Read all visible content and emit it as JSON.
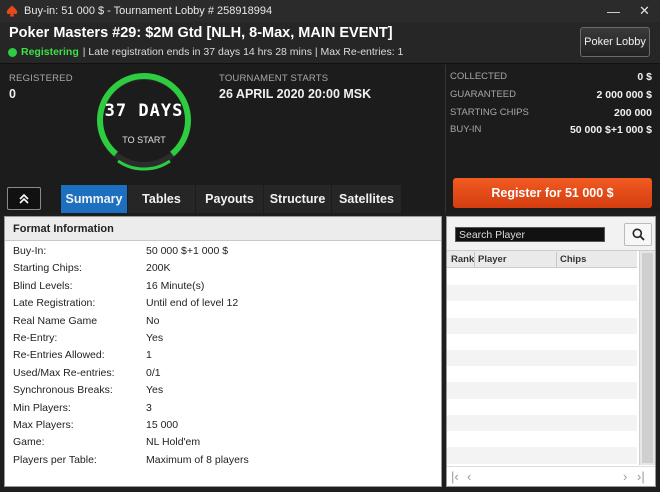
{
  "window": {
    "title": "Buy-in: 51 000 $ - Tournament Lobby # 258918994",
    "app_icon": "spade-icon",
    "colors": {
      "accent_tab": "#1d6fbf",
      "register": "#e8491a",
      "registering": "#2ecc40",
      "timer_ring": "#2ecc40"
    }
  },
  "header": {
    "tournament_name": "Poker Masters #29: $2M Gtd [NLH, 8-Max, MAIN EVENT]",
    "status": "Registering",
    "status_detail": "| Late registration ends in 37 days 14 hrs  28 mins  | Max Re-entries: 1",
    "lobby_button": "Poker Lobby"
  },
  "stats": {
    "registered_label": "REGISTERED",
    "registered_value": "0",
    "starts_label": "TOURNAMENT STARTS",
    "starts_value": "26 APRIL 2020  20:00 MSK",
    "countdown_value": "37 DAYS",
    "countdown_sub": "TO START"
  },
  "collected": [
    {
      "label": "COLLECTED",
      "value": "0 $"
    },
    {
      "label": "GUARANTEED",
      "value": "2 000 000 $"
    },
    {
      "label": "STARTING CHIPS",
      "value": "200 000"
    },
    {
      "label": "BUY-IN",
      "value": "50 000 $+1 000 $"
    }
  ],
  "register_button": "Register for  51 000 $",
  "tabs": [
    {
      "label": "Summary",
      "active": true
    },
    {
      "label": "Tables",
      "active": false
    },
    {
      "label": "Payouts",
      "active": false
    },
    {
      "label": "Structure",
      "active": false
    },
    {
      "label": "Satellites",
      "active": false
    }
  ],
  "format": {
    "title": "Format Information",
    "rows": [
      {
        "key": "Buy-In:",
        "value": "50 000 $+1 000 $"
      },
      {
        "key": "Starting Chips:",
        "value": "200K"
      },
      {
        "key": "Blind Levels:",
        "value": "16 Minute(s)"
      },
      {
        "key": "Late Registration:",
        "value": "Until end of level 12"
      },
      {
        "key": "Real Name Game",
        "value": "No"
      },
      {
        "key": "Re-Entry:",
        "value": "Yes"
      },
      {
        "key": "Re-Entries Allowed:",
        "value": "1"
      },
      {
        "key": "Used/Max Re-entries:",
        "value": "0/1"
      },
      {
        "key": "Synchronous Breaks:",
        "value": "Yes"
      },
      {
        "key": "Min Players:",
        "value": "3"
      },
      {
        "key": "Max Players:",
        "value": "15 000"
      },
      {
        "key": "Game:",
        "value": "NL Hold'em"
      },
      {
        "key": "Players per Table:",
        "value": "Maximum of 8 players"
      }
    ]
  },
  "players": {
    "search_placeholder": "Search Player",
    "search_icon": "magnifier-icon",
    "columns": [
      "Rank",
      "Player",
      "Chips"
    ]
  }
}
